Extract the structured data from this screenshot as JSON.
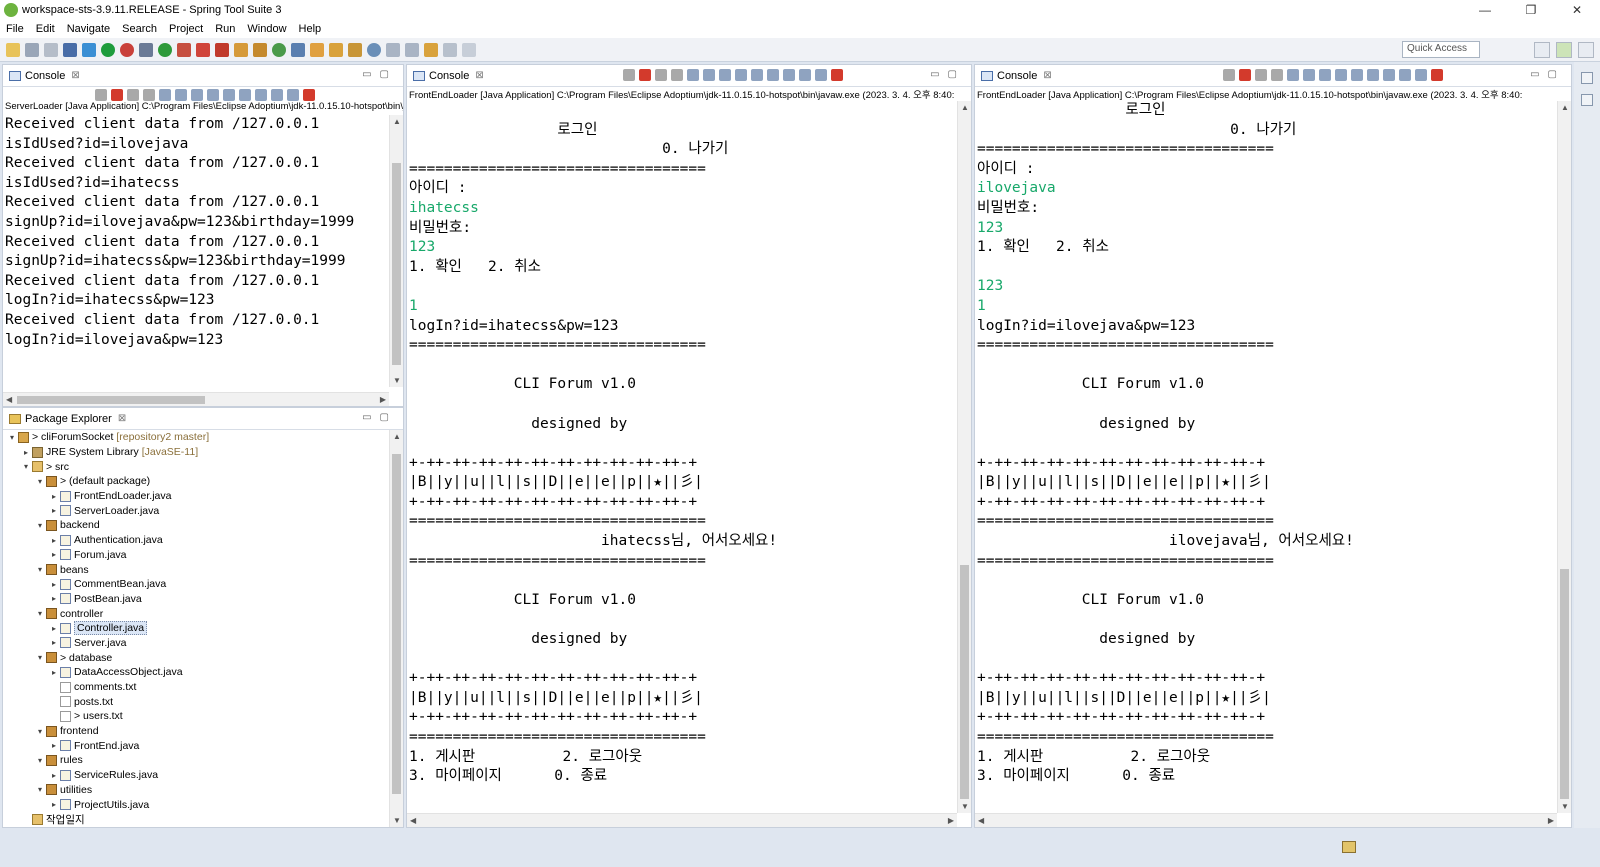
{
  "window": {
    "title": "workspace-sts-3.9.11.RELEASE - Spring Tool Suite 3",
    "minimize": "—",
    "maximize": "❐",
    "close": "✕"
  },
  "menu": [
    "File",
    "Edit",
    "Navigate",
    "Search",
    "Project",
    "Run",
    "Window",
    "Help"
  ],
  "toolbar": {
    "quick_access": "Quick Access"
  },
  "consoles": [
    {
      "tab": "Console",
      "launch": "ServerLoader [Java Application] C:\\Program Files\\Eclipse Adoptium\\jdk-11.0.15.10-hotspot\\bin\\javaw.exe",
      "lines": [
        {
          "t": "Received client data from /127.0.0.1"
        },
        {
          "t": "isIdUsed?id=ilovejava"
        },
        {
          "t": "Received client data from /127.0.0.1"
        },
        {
          "t": "isIdUsed?id=ihatecss"
        },
        {
          "t": "Received client data from /127.0.0.1"
        },
        {
          "t": "signUp?id=ilovejava&pw=123&birthday=1999"
        },
        {
          "t": "Received client data from /127.0.0.1"
        },
        {
          "t": "signUp?id=ihatecss&pw=123&birthday=1999"
        },
        {
          "t": "Received client data from /127.0.0.1"
        },
        {
          "t": "logIn?id=ihatecss&pw=123"
        },
        {
          "t": "Received client data from /127.0.0.1"
        },
        {
          "t": "logIn?id=ilovejava&pw=123"
        }
      ]
    },
    {
      "tab": "Console",
      "launch": "FrontEndLoader [Java Application] C:\\Program Files\\Eclipse Adoptium\\jdk-11.0.15.10-hotspot\\bin\\javaw.exe (2023. 3. 4. 오후 8:40:",
      "lines": [
        {
          "t": ""
        },
        {
          "t": "                 로그인"
        },
        {
          "t": "                             0. 나가기"
        },
        {
          "t": "=================================="
        },
        {
          "t": "아이디 :"
        },
        {
          "t": "ihatecss",
          "input": true
        },
        {
          "t": "비밀번호:"
        },
        {
          "t": "123",
          "input": true
        },
        {
          "t": "1. 확인   2. 취소"
        },
        {
          "t": ""
        },
        {
          "t": "1",
          "input": true
        },
        {
          "t": "logIn?id=ihatecss&pw=123"
        },
        {
          "t": "=================================="
        },
        {
          "t": ""
        },
        {
          "t": "            CLI Forum v1.0"
        },
        {
          "t": ""
        },
        {
          "t": "              designed by"
        },
        {
          "t": ""
        },
        {
          "t": "+-++-++-++-++-++-++-++-++-++-++-+"
        },
        {
          "t": "|B||y||u||l||s||D||e||e||p||★||彡|"
        },
        {
          "t": "+-++-++-++-++-++-++-++-++-++-++-+"
        },
        {
          "t": "=================================="
        },
        {
          "t": "                      ihatecss님, 어서오세요!"
        },
        {
          "t": "=================================="
        },
        {
          "t": ""
        },
        {
          "t": "            CLI Forum v1.0"
        },
        {
          "t": ""
        },
        {
          "t": "              designed by"
        },
        {
          "t": ""
        },
        {
          "t": "+-++-++-++-++-++-++-++-++-++-++-+"
        },
        {
          "t": "|B||y||u||l||s||D||e||e||p||★||彡|"
        },
        {
          "t": "+-++-++-++-++-++-++-++-++-++-++-+"
        },
        {
          "t": "=================================="
        },
        {
          "t": "1. 게시판          2. 로그아웃"
        },
        {
          "t": "3. 마이페이지      0. 종료"
        }
      ]
    },
    {
      "tab": "Console",
      "launch": "FrontEndLoader [Java Application] C:\\Program Files\\Eclipse Adoptium\\jdk-11.0.15.10-hotspot\\bin\\javaw.exe (2023. 3. 4. 오후 8:40:",
      "lines": [
        {
          "t": "                 로그인"
        },
        {
          "t": "                             0. 나가기"
        },
        {
          "t": "=================================="
        },
        {
          "t": "아이디 :"
        },
        {
          "t": "ilovejava",
          "input": true
        },
        {
          "t": "비밀번호:"
        },
        {
          "t": "123",
          "input": true
        },
        {
          "t": "1. 확인   2. 취소"
        },
        {
          "t": ""
        },
        {
          "t": "123",
          "input": true
        },
        {
          "t": "1",
          "input": true
        },
        {
          "t": "logIn?id=ilovejava&pw=123"
        },
        {
          "t": "=================================="
        },
        {
          "t": ""
        },
        {
          "t": "            CLI Forum v1.0"
        },
        {
          "t": ""
        },
        {
          "t": "              designed by"
        },
        {
          "t": ""
        },
        {
          "t": "+-++-++-++-++-++-++-++-++-++-++-+"
        },
        {
          "t": "|B||y||u||l||s||D||e||e||p||★||彡|"
        },
        {
          "t": "+-++-++-++-++-++-++-++-++-++-++-+"
        },
        {
          "t": "=================================="
        },
        {
          "t": "                      ilovejava님, 어서오세요!"
        },
        {
          "t": "=================================="
        },
        {
          "t": ""
        },
        {
          "t": "            CLI Forum v1.0"
        },
        {
          "t": ""
        },
        {
          "t": "              designed by"
        },
        {
          "t": ""
        },
        {
          "t": "+-++-++-++-++-++-++-++-++-++-++-+"
        },
        {
          "t": "|B||y||u||l||s||D||e||e||p||★||彡|"
        },
        {
          "t": "+-++-++-++-++-++-++-++-++-++-++-+"
        },
        {
          "t": "=================================="
        },
        {
          "t": "1. 게시판          2. 로그아웃"
        },
        {
          "t": "3. 마이페이지      0. 종료"
        }
      ]
    }
  ],
  "explorer": {
    "tab": "Package Explorer",
    "items": [
      {
        "level": 0,
        "twisty": "v",
        "icon": "proj",
        "label": "> cliForumSocket",
        "extra": " [repository2 master]"
      },
      {
        "level": 1,
        "twisty": ">",
        "icon": "lib",
        "label": "JRE System Library",
        "extra": " [JavaSE-11]"
      },
      {
        "level": 1,
        "twisty": "v",
        "icon": "folder",
        "label": "> src"
      },
      {
        "level": 2,
        "twisty": "v",
        "icon": "pkg",
        "label": "> (default package)"
      },
      {
        "level": 3,
        "twisty": ">",
        "icon": "java",
        "label": "FrontEndLoader.java"
      },
      {
        "level": 3,
        "twisty": ">",
        "icon": "java",
        "label": "ServerLoader.java"
      },
      {
        "level": 2,
        "twisty": "v",
        "icon": "pkg",
        "label": "backend"
      },
      {
        "level": 3,
        "twisty": ">",
        "icon": "java",
        "label": "Authentication.java"
      },
      {
        "level": 3,
        "twisty": ">",
        "icon": "java",
        "label": "Forum.java"
      },
      {
        "level": 2,
        "twisty": "v",
        "icon": "pkg",
        "label": "beans"
      },
      {
        "level": 3,
        "twisty": ">",
        "icon": "java",
        "label": "CommentBean.java"
      },
      {
        "level": 3,
        "twisty": ">",
        "icon": "java",
        "label": "PostBean.java"
      },
      {
        "level": 2,
        "twisty": "v",
        "icon": "pkg",
        "label": "controller"
      },
      {
        "level": 3,
        "twisty": ">",
        "icon": "java",
        "label": "Controller.java",
        "selected": true
      },
      {
        "level": 3,
        "twisty": ">",
        "icon": "java",
        "label": "Server.java"
      },
      {
        "level": 2,
        "twisty": "v",
        "icon": "pkg",
        "label": "> database"
      },
      {
        "level": 3,
        "twisty": ">",
        "icon": "java",
        "label": "DataAccessObject.java"
      },
      {
        "level": 3,
        "twisty": "",
        "icon": "txt",
        "label": "comments.txt"
      },
      {
        "level": 3,
        "twisty": "",
        "icon": "txt",
        "label": "posts.txt"
      },
      {
        "level": 3,
        "twisty": "",
        "icon": "txt",
        "label": "> users.txt"
      },
      {
        "level": 2,
        "twisty": "v",
        "icon": "pkg",
        "label": "frontend"
      },
      {
        "level": 3,
        "twisty": ">",
        "icon": "java",
        "label": "FrontEnd.java"
      },
      {
        "level": 2,
        "twisty": "v",
        "icon": "pkg",
        "label": "rules"
      },
      {
        "level": 3,
        "twisty": ">",
        "icon": "java",
        "label": "ServiceRules.java"
      },
      {
        "level": 2,
        "twisty": "v",
        "icon": "pkg",
        "label": "utilities"
      },
      {
        "level": 3,
        "twisty": ">",
        "icon": "java",
        "label": "ProjectUtils.java"
      },
      {
        "level": 1,
        "twisty": "",
        "icon": "folder",
        "label": "작업일지"
      }
    ]
  },
  "colors": {
    "input_text": "#18a86a",
    "selection": "#dbe6f6"
  }
}
